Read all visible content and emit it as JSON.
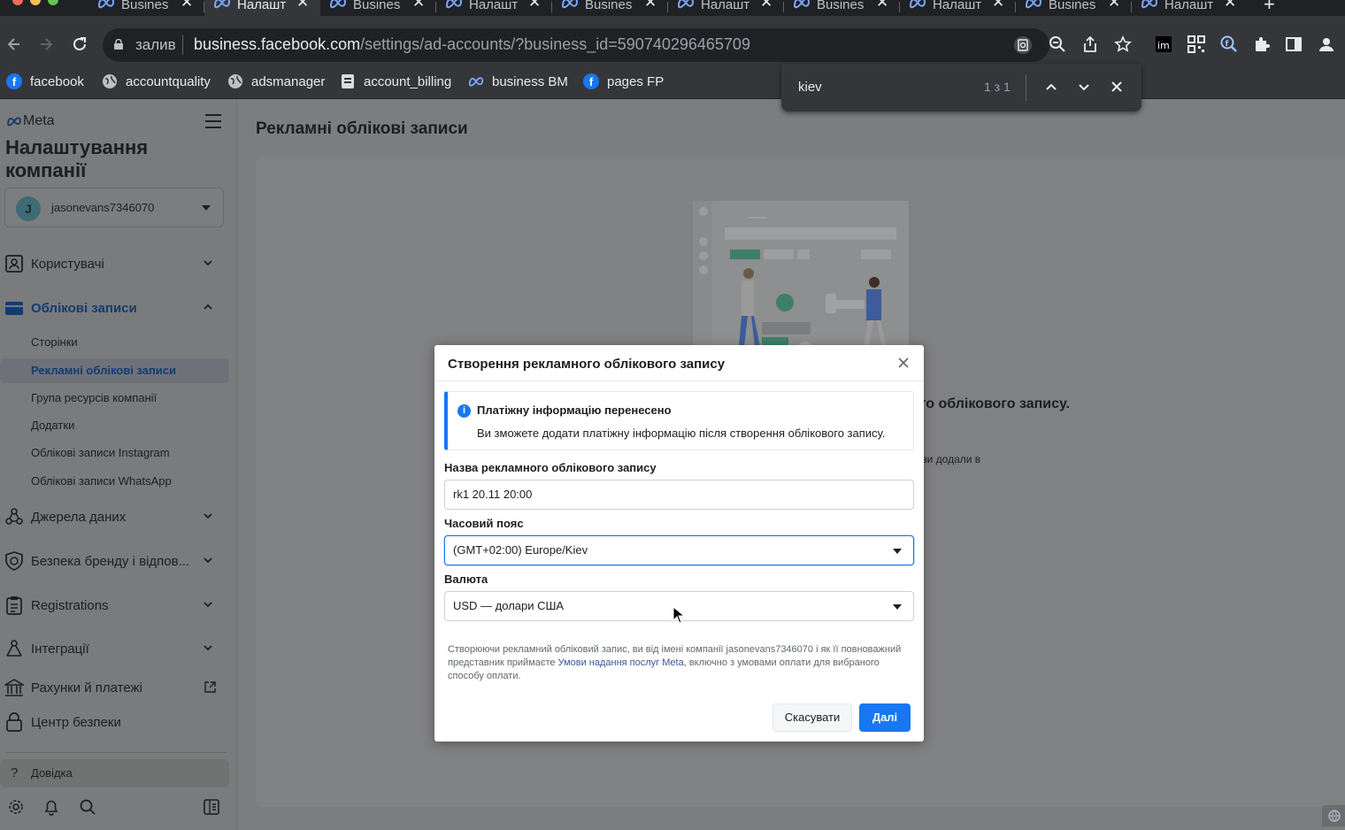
{
  "browser": {
    "tabs": [
      {
        "label": "Busines",
        "active": false
      },
      {
        "label": "Налашт",
        "active": true
      },
      {
        "label": "Busines",
        "active": false
      },
      {
        "label": "Налашт",
        "active": false
      },
      {
        "label": "Busines",
        "active": false
      },
      {
        "label": "Налашт",
        "active": false
      },
      {
        "label": "Busines",
        "active": false
      },
      {
        "label": "Налашт",
        "active": false
      },
      {
        "label": "Busines",
        "active": false
      },
      {
        "label": "Налашт",
        "active": false
      }
    ],
    "tab_close_glyph": "✕",
    "new_tab_glyph": "+",
    "omnibox": {
      "chip": "залив",
      "url_host": "business.facebook.com",
      "url_path": "/settings/ad-accounts/?business_id=590740296465709"
    },
    "bookmarks": [
      {
        "label": "facebook",
        "icon": "facebook-icon"
      },
      {
        "label": "accountquality",
        "icon": "globe-icon"
      },
      {
        "label": "adsmanager",
        "icon": "globe-icon"
      },
      {
        "label": "account_billing",
        "icon": "document-icon"
      },
      {
        "label": "business BM",
        "icon": "meta-icon"
      },
      {
        "label": "pages FP",
        "icon": "facebook-icon"
      }
    ],
    "find": {
      "query": "kiev",
      "count": "1 з 1"
    }
  },
  "sidebar": {
    "logo_text": "Meta",
    "title": "Налаштування компанії",
    "account": {
      "initial": "J",
      "name": "jasonevans7346070"
    },
    "items": [
      {
        "label": "Користувачі",
        "icon": "users-icon"
      },
      {
        "label": "Облікові записи",
        "icon": "accounts-icon"
      },
      {
        "label": "Джерела даних",
        "icon": "data-sources-icon"
      },
      {
        "label": "Безпека бренду і відпов...",
        "icon": "shield-icon"
      },
      {
        "label": "Registrations",
        "icon": "clipboard-icon"
      },
      {
        "label": "Інтеграції",
        "icon": "integrations-icon"
      },
      {
        "label": "Рахунки й платежі",
        "icon": "bank-icon"
      },
      {
        "label": "Центр безпеки",
        "icon": "lock-icon"
      }
    ],
    "subitems": [
      {
        "label": "Сторінки"
      },
      {
        "label": "Рекламні облікові записи"
      },
      {
        "label": "Група ресурсів компанії"
      },
      {
        "label": "Додатки"
      },
      {
        "label": "Облікові записи Instagram"
      },
      {
        "label": "Облікові записи WhatsApp"
      }
    ],
    "help": "Довідка",
    "help_icon_glyph": "?"
  },
  "main": {
    "heading": "Рекламні облікові записи",
    "bg_heading_partial": "ого облікового запису.",
    "bg_sub_partial": "кі ви додали в"
  },
  "modal": {
    "title": "Створення рекламного облікового запису",
    "info": {
      "icon_glyph": "i",
      "title": "Платіжну інформацію перенесено",
      "body": "Ви зможете додати платіжну інформацію після створення облікового запису."
    },
    "name_label": "Назва рекламного облікового запису",
    "name_value": "rk1 20.11 20:00",
    "timezone_label": "Часовий пояс",
    "timezone_value": "(GMT+02:00) Europe/Kiev",
    "currency_label": "Валюта",
    "currency_value": "USD — долари США",
    "terms_before": "Створюючи рекламний обліковий запис, ви від імені компанії jasonevans7346070 і як її повноважний представник приймаєте ",
    "terms_link": "Умови надання послуг Meta",
    "terms_after": ", включно з умовами оплати для вибраного способу оплати.",
    "cancel_label": "Скасувати",
    "next_label": "Далі"
  },
  "colors": {
    "accent": "#1877f2",
    "link": "#385898",
    "overlay": "#7c7d7e",
    "chrome_dark": "#202124",
    "chrome_toolbar": "#35363a"
  }
}
